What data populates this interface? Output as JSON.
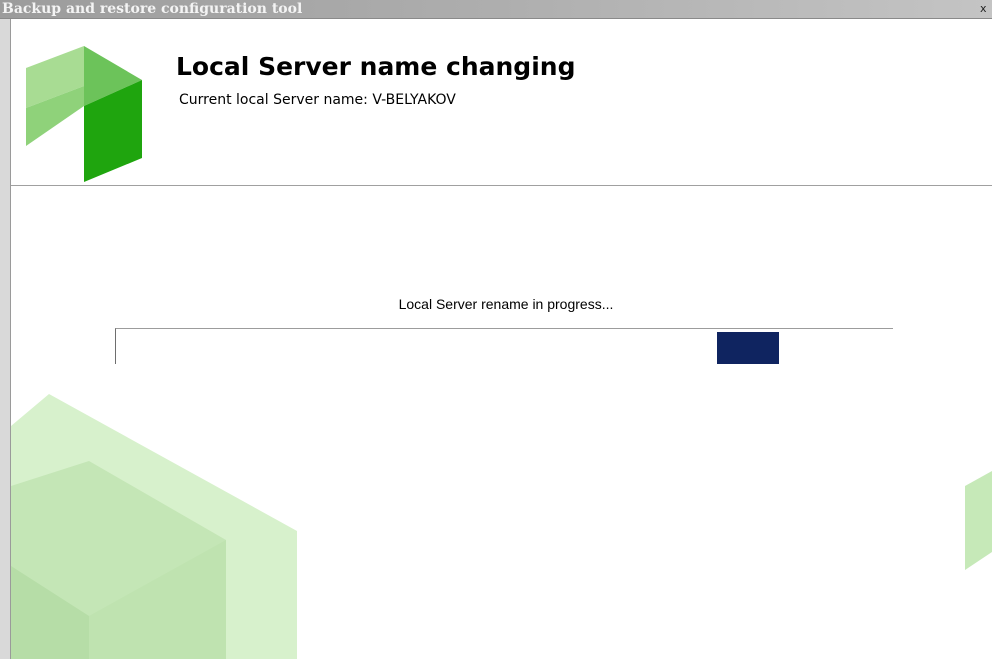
{
  "window": {
    "title": "Backup and restore configuration tool",
    "close_label": "x"
  },
  "header": {
    "title": "Local Server name changing",
    "subtitle": "Current local Server name: V-BELYAKOV",
    "logo_icon": "cube-logo-icon"
  },
  "main": {
    "status_text": "Local Server rename in progress...",
    "progress": {
      "style": "marquee",
      "color": "#0f2460"
    }
  },
  "colors": {
    "brand_green_dark": "#1fa50e",
    "brand_green_mid": "#6cc35a",
    "brand_green_light": "#a8dc93",
    "decor_green": "#cdeec0",
    "titlebar": "#a8a8a8"
  }
}
